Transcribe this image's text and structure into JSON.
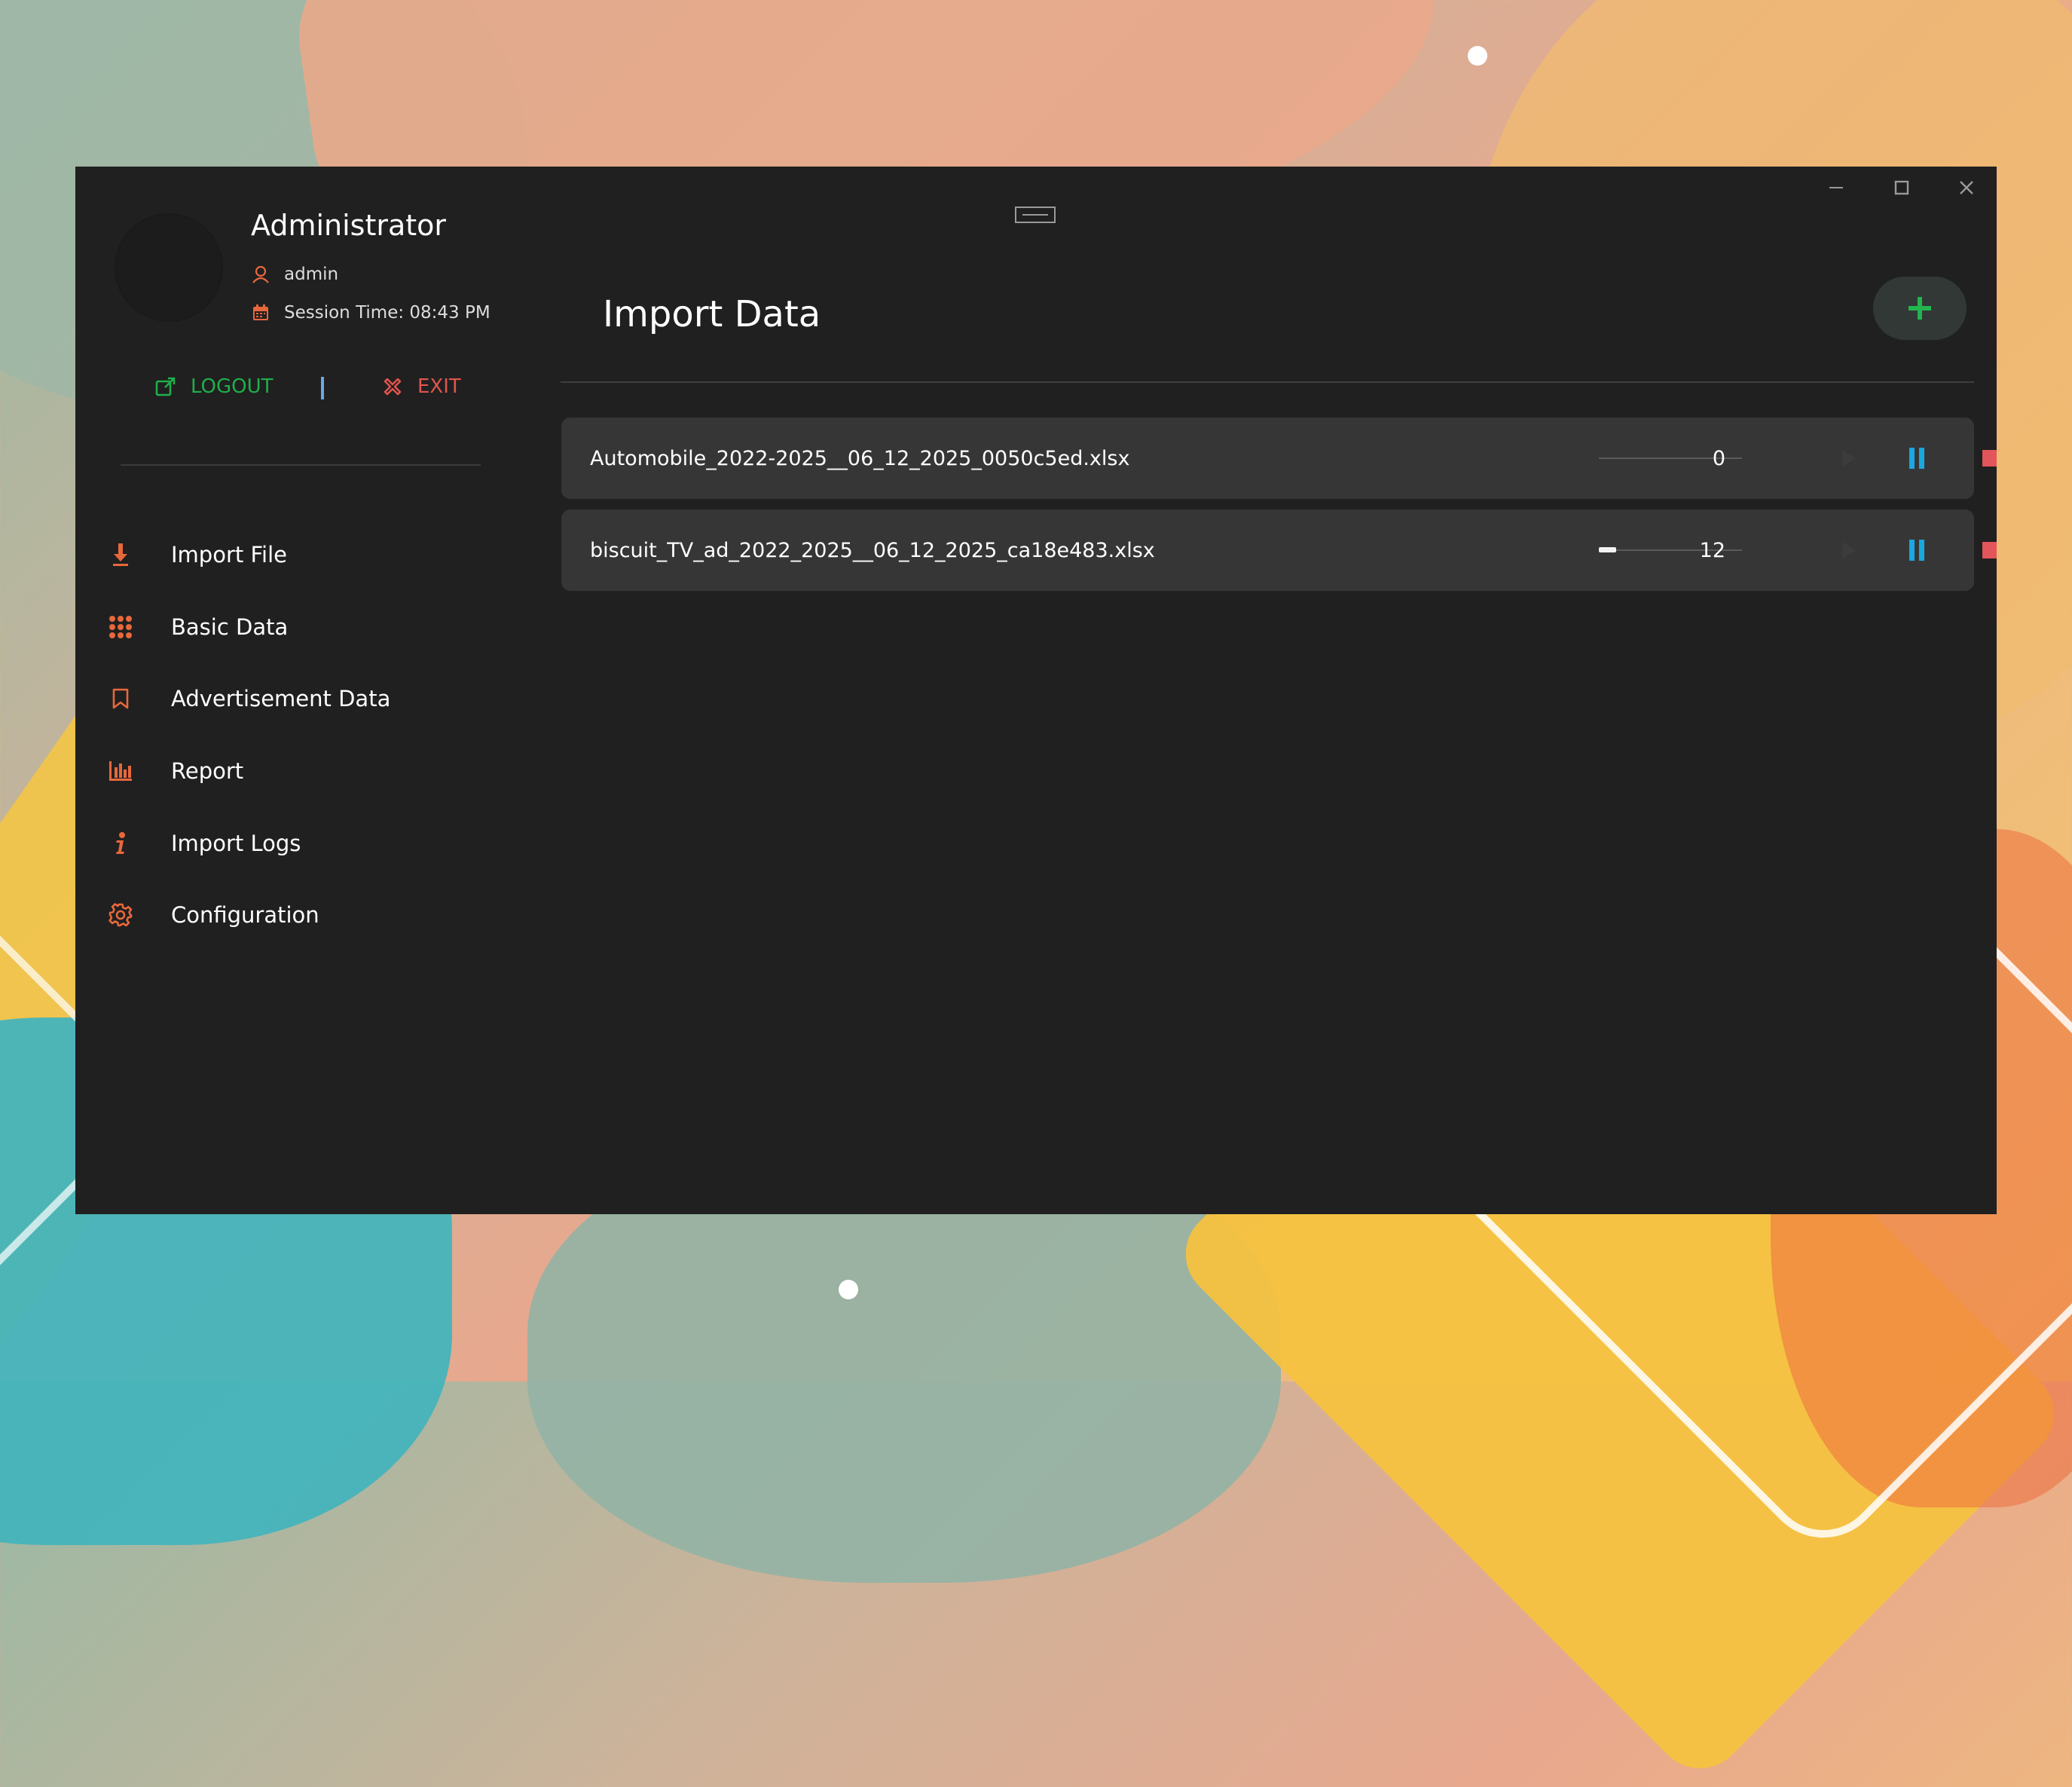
{
  "user": {
    "name": "Administrator",
    "username": "admin",
    "session": "Session Time: 08:43 PM"
  },
  "actions": {
    "logout_label": "LOGOUT",
    "exit_label": "EXIT"
  },
  "nav": {
    "items": [
      {
        "label": "Import File",
        "icon": "download-icon"
      },
      {
        "label": "Basic Data",
        "icon": "grid-icon"
      },
      {
        "label": "Advertisement Data",
        "icon": "bookmark-icon"
      },
      {
        "label": "Report",
        "icon": "bar-chart-icon"
      },
      {
        "label": "Import Logs",
        "icon": "info-icon"
      },
      {
        "label": "Configuration",
        "icon": "gear-icon"
      }
    ]
  },
  "page": {
    "title": "Import Data"
  },
  "imports": [
    {
      "file": "Automobile_2022-2025__06_12_2025_0050c5ed.xlsx",
      "count": "0",
      "progress": 0
    },
    {
      "file": "biscuit_TV_ad_2022_2025__06_12_2025_ca18e483.xlsx",
      "count": "12",
      "progress": 0.12
    }
  ],
  "colors": {
    "accent_icon": "#e8683c",
    "logout": "#1eaf4a",
    "exit": "#e2554e",
    "pause": "#19a8e0",
    "stop": "#e2555a",
    "add": "#22b54e"
  }
}
